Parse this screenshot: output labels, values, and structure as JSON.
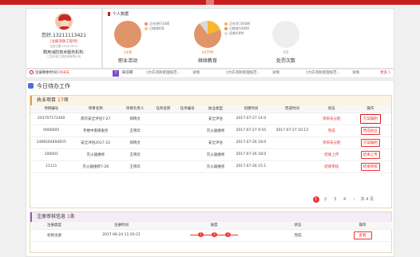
{
  "profile": {
    "name": "您好,13211113421",
    "tag": "（注册消防工程师）",
    "cert_date": "注册日期 2016-06-24",
    "org": "聘用消防技术服务机构:",
    "org_name": "江苏中政工程咨询有限公司",
    "reg_prefix": "注册剩余时间",
    "reg_days": "1068天"
  },
  "stats": {
    "title": "个人数据",
    "pies": [
      {
        "value": "14项",
        "label": "职业活动",
        "legend": [
          "正在进行14项",
          "已结束0项"
        ],
        "colors": [
          "#e0946a",
          "#f2c58c"
        ]
      },
      {
        "value": "20学时",
        "label": "继续教育",
        "legend": [
          "正在学习4学时",
          "已结束14学时",
          "还差4学时"
        ],
        "colors": [
          "#f6b731",
          "#e0946a",
          "#d9d9d9"
        ]
      },
      {
        "value": "0次",
        "label": "处罚次数",
        "legend": [],
        "colors": [
          "#eeeeee"
        ]
      }
    ]
  },
  "kb": {
    "label": "知识库",
    "items": [
      "《大庆消防管理规范...",
      "详情",
      "《大庆消防管理规范...",
      "详情",
      "《大庆消防管理规范...",
      "详情"
    ],
    "more": "更多 》"
  },
  "todo": {
    "title": "今日待办工作"
  },
  "projects": {
    "title_prefix": "执业项目",
    "count": "17",
    "unit": "项",
    "columns": [
      "项目编号",
      "项目名称",
      "项目负责人",
      "任务名称",
      "任务编号",
      "执业类型",
      "创建时间",
      "完成时间",
      "状态",
      "操作"
    ],
    "rows": [
      [
        "201707171400",
        "南京安全评估7-27",
        "郑晓文",
        "",
        "",
        "安全评估",
        "2017-07-27 14:0",
        "",
        "项目未分配",
        "方案编制"
      ],
      [
        "0000005",
        "专楼中南南服务",
        "王晓华",
        "",
        "",
        "灭火器维修",
        "2017-07-27 9:55",
        "2017-07-27 10:13",
        "完成",
        "完成执业"
      ],
      [
        "1496564694655",
        "安全评估2017-22",
        "郑晓文",
        "",
        "",
        "安全评估",
        "2017-07-26 18:0",
        "",
        "项目未分配",
        "方案编制"
      ],
      [
        "100001",
        "灭火器维修",
        "王晓华",
        "",
        "",
        "灭火器维修",
        "2017-07-26 18:0",
        "",
        "结果上传",
        "结果上传"
      ],
      [
        "11111",
        "灭火器维修7-26",
        "王晓华",
        "",
        "",
        "灭火器维修",
        "2017-07-26 15:1",
        "",
        "结果审核",
        "结果审核"
      ]
    ],
    "pager": {
      "pages": [
        "1",
        "2",
        "3",
        "4",
        "›"
      ],
      "total": "共 4 页"
    }
  },
  "review": {
    "title_prefix": "注册审核信息",
    "count": "1",
    "unit": "条",
    "columns": [
      "注册类型",
      "注册时间",
      "进度",
      "状态",
      "操作"
    ],
    "rows": [
      [
        "初始注册",
        "2017-06-24 11:20:21",
        "",
        "完成",
        "查看"
      ]
    ],
    "steps": [
      "1",
      "2",
      "3"
    ]
  }
}
